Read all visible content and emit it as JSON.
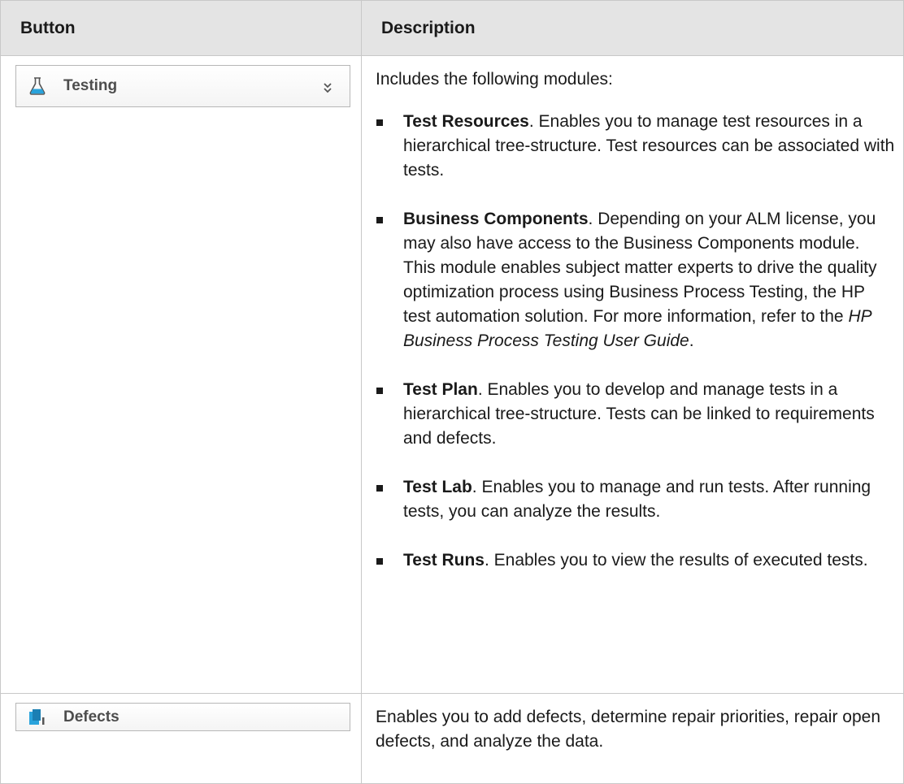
{
  "header": {
    "button_col": "Button",
    "description_col": "Description"
  },
  "rows": {
    "testing": {
      "button_label": "Testing",
      "button_icon": "flask-icon",
      "intro": "Includes the following modules:",
      "items": [
        {
          "term": "Test Resources",
          "text": ". Enables you to manage test resources in a hierarchical tree-structure. Test resources can be associated with tests."
        },
        {
          "term": "Business Components",
          "text": ". Depending on your ALM license, you may also have access to the Business Components module. This module enables subject matter experts to drive the quality optimization process using Business Process Testing, the HP test automation solution. For more information, refer to the ",
          "ref": "HP Business Process Testing User Guide",
          "end": "."
        },
        {
          "term": "Test Plan",
          "text": ". Enables you to develop and manage tests in a hierarchical tree-structure. Tests can be linked to requirements and defects."
        },
        {
          "term": "Test Lab",
          "text": ". Enables you to manage and run tests. After running tests, you can analyze the results."
        },
        {
          "term": "Test Runs",
          "text": ". Enables you to view the results of executed tests."
        }
      ]
    },
    "defects": {
      "button_label": "Defects",
      "button_icon": "defects-icon",
      "description": "Enables you to add defects, determine repair priorities, repair open defects, and analyze the data."
    }
  },
  "colors": {
    "header_bg": "#e4e4e4",
    "border": "#c8c8c8",
    "icon_blue": "#29a3dc"
  }
}
